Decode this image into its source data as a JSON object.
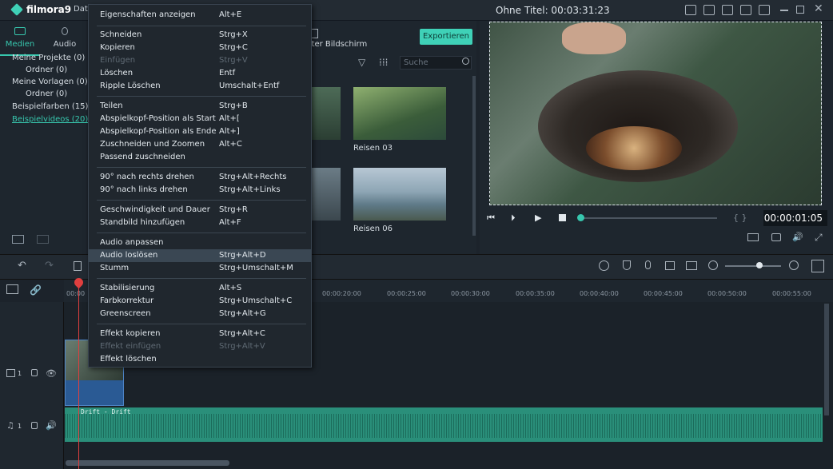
{
  "app": {
    "name": "filmora9",
    "menu_partial": "Dat",
    "project_title": "Ohne Titel: 00:03:31:23"
  },
  "left_panel": {
    "tabs": [
      {
        "label": "Medien"
      },
      {
        "label": "Audio"
      }
    ],
    "tree": [
      "Meine Projekte (0)",
      "Ordner (0)",
      "Meine Vorlagen (0)",
      "Ordner (0)",
      "Beispielfarben (15)",
      "Beispielvideos (20)"
    ]
  },
  "media": {
    "split_label": "ilter Bildschirm",
    "export_label": "Exportieren",
    "search_placeholder": "Suche",
    "items": [
      {
        "label": "Reisen 03"
      },
      {
        "label": "Reisen 06"
      }
    ]
  },
  "preview": {
    "timecode": "00:00:01:05"
  },
  "ruler": [
    "00:00",
    "00:00:20:00",
    "00:00:25:00",
    "00:00:30:00",
    "00:00:35:00",
    "00:00:40:00",
    "00:00:45:00",
    "00:00:50:00",
    "00:00:55:00"
  ],
  "tracks": {
    "video_index": "1",
    "audio_index": "1",
    "audio_clip_label": "Drift - Drift"
  },
  "context_menu": [
    {
      "label": "Eigenschaften anzeigen",
      "shortcut": "Alt+E"
    },
    {
      "label": "Schneiden",
      "shortcut": "Strg+X"
    },
    {
      "label": "Kopieren",
      "shortcut": "Strg+C"
    },
    {
      "label": "Einfügen",
      "shortcut": "Strg+V"
    },
    {
      "label": "Löschen",
      "shortcut": "Entf"
    },
    {
      "label": "Ripple Löschen",
      "shortcut": "Umschalt+Entf"
    },
    {
      "label": "Teilen",
      "shortcut": "Strg+B"
    },
    {
      "label": "Abspielkopf-Position als Start",
      "shortcut": "Alt+["
    },
    {
      "label": "Abspielkopf-Position als Ende",
      "shortcut": "Alt+]"
    },
    {
      "label": "Zuschneiden und Zoomen",
      "shortcut": "Alt+C"
    },
    {
      "label": "Passend zuschneiden",
      "shortcut": ""
    },
    {
      "label": "90° nach rechts drehen",
      "shortcut": "Strg+Alt+Rechts"
    },
    {
      "label": "90° nach links drehen",
      "shortcut": "Strg+Alt+Links"
    },
    {
      "label": "Geschwindigkeit und Dauer",
      "shortcut": "Strg+R"
    },
    {
      "label": "Standbild hinzufügen",
      "shortcut": "Alt+F"
    },
    {
      "label": "Audio anpassen",
      "shortcut": ""
    },
    {
      "label": "Audio loslösen",
      "shortcut": "Strg+Alt+D"
    },
    {
      "label": "Stumm",
      "shortcut": "Strg+Umschalt+M"
    },
    {
      "label": "Stabilisierung",
      "shortcut": "Alt+S"
    },
    {
      "label": "Farbkorrektur",
      "shortcut": "Strg+Umschalt+C"
    },
    {
      "label": "Greenscreen",
      "shortcut": "Strg+Alt+G"
    },
    {
      "label": "Effekt kopieren",
      "shortcut": "Strg+Alt+C"
    },
    {
      "label": "Effekt einfügen",
      "shortcut": "Strg+Alt+V"
    },
    {
      "label": "Effekt löschen",
      "shortcut": ""
    }
  ]
}
